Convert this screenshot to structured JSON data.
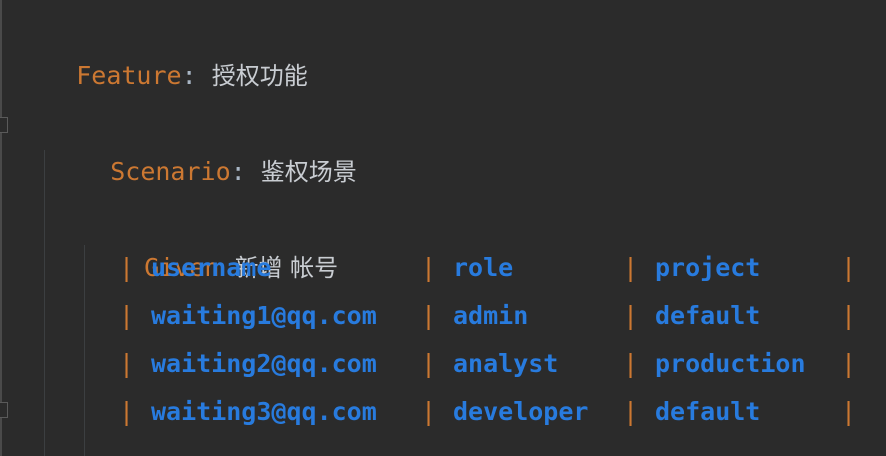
{
  "colors": {
    "background": "#2b2b2b",
    "keyword": "#cc7832",
    "text": "#a9b7c6",
    "table_cell": "#287bde"
  },
  "feature": {
    "keyword": "Feature",
    "colon": ":",
    "title": "授权功能"
  },
  "scenario": {
    "keyword": "Scenario",
    "colon": ":",
    "title": "鉴权场景"
  },
  "step": {
    "keyword": "Given",
    "text": "新增 帐号"
  },
  "table": {
    "rows": [
      [
        "username",
        "role",
        "project"
      ],
      [
        "waiting1@qq.com",
        "admin",
        "default"
      ],
      [
        "waiting2@qq.com",
        "analyst",
        "production"
      ],
      [
        "waiting3@qq.com",
        "developer",
        "default"
      ]
    ]
  }
}
